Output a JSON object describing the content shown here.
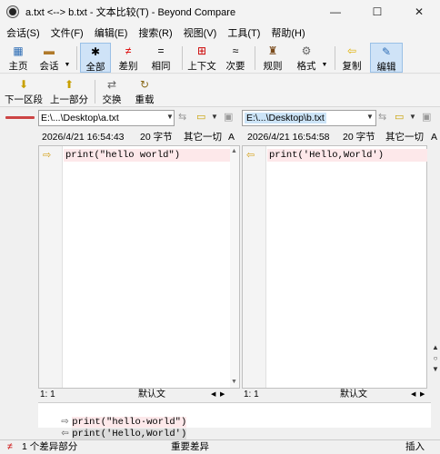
{
  "window": {
    "title": "a.txt <--> b.txt - 文本比较(T) - Beyond Compare",
    "minimize": "—",
    "maximize": "☐",
    "close": "✕"
  },
  "menu": [
    "会话(S)",
    "文件(F)",
    "编辑(E)",
    "搜索(R)",
    "视图(V)",
    "工具(T)",
    "帮助(H)"
  ],
  "toolbar1": {
    "home": "主页",
    "session": "会话",
    "all": "全部",
    "diffs": "差别",
    "same": "相同",
    "context": "上下文",
    "minor": "次要",
    "rules": "规则",
    "format": "格式",
    "copy": "复制",
    "edit": "编辑"
  },
  "toolbar2": {
    "next_section": "下一区段",
    "prev_section": "上一部分",
    "swap": "交换",
    "reload": "重载"
  },
  "left": {
    "path": "E:\\...\\Desktop\\a.txt",
    "date": "2026/4/21 16:54:43",
    "size": "20 字节",
    "eol": "其它一切",
    "enc": "A",
    "line": "print(\"hello world\")",
    "pos": "1: 1",
    "mode": "默认文"
  },
  "right": {
    "path": "E:\\...\\Desktop\\b.txt",
    "date": "2026/4/21 16:54:58",
    "size": "20 字节",
    "eol": "其它一切",
    "enc": "A",
    "line": "print('Hello,World')",
    "pos": "1: 1",
    "mode": "默认文"
  },
  "bottom": {
    "line1": "print(\"hello·world\")",
    "line2": "print('Hello,World')"
  },
  "status": {
    "diff_count": "1 个差异部分",
    "important": "重要差异",
    "insert": "插入"
  },
  "colors": {
    "diff_bg": "#fde8ea",
    "active_btn": "#cfe3f7",
    "path_selected": "#cce4f7"
  }
}
